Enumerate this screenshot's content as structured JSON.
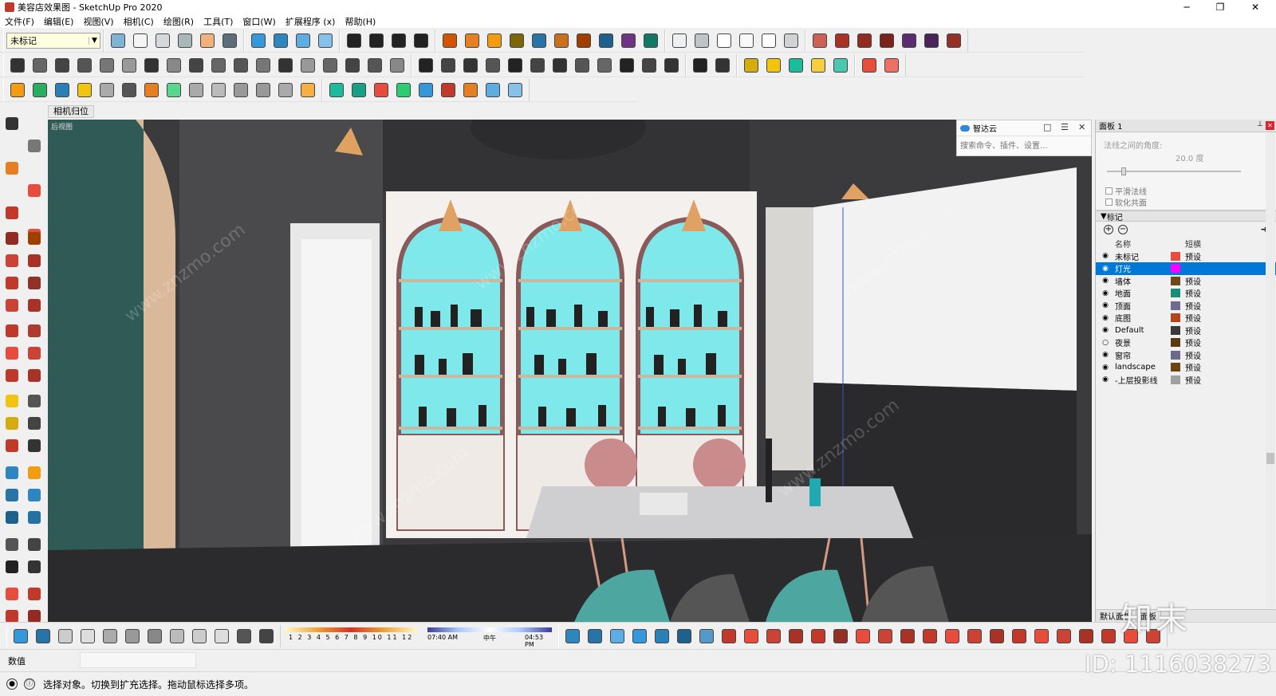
{
  "window": {
    "title": "美容店效果图 - SketchUp Pro 2020",
    "minimize": "─",
    "maximize": "❐",
    "close": "✕"
  },
  "menu": [
    "文件(F)",
    "编辑(E)",
    "视图(V)",
    "相机(C)",
    "绘图(R)",
    "工具(T)",
    "窗口(W)",
    "扩展程序 (x)",
    "帮助(H)"
  ],
  "toolbar": {
    "active_tag": "未标记"
  },
  "scene_tab": "相机归位",
  "viewport": {
    "label": "后视图",
    "watermark": "www.znzmo.com"
  },
  "search": {
    "title": "智达云",
    "placeholder": "搜索命令、插件、设置..."
  },
  "tray": {
    "title": "面板 1",
    "soften": {
      "angle_label": "法线之间的角度:",
      "angle_value": "20.0 度",
      "smooth_normals": "平滑法线",
      "soften_coplanar": "软化共面"
    },
    "tags_section_title": "标记",
    "tags_headers": {
      "name": "名称",
      "dash": "短横"
    },
    "tags": [
      {
        "name": "未标记",
        "color": "#e84c3d",
        "dash": "预设",
        "visible": true
      },
      {
        "name": "灯光",
        "color": "#ff00ff",
        "dash": "",
        "visible": true,
        "selected": true
      },
      {
        "name": "墙体",
        "color": "#6b4a1a",
        "dash": "预设",
        "visible": true
      },
      {
        "name": "地面",
        "color": "#1a8c7a",
        "dash": "预设",
        "visible": true
      },
      {
        "name": "顶面",
        "color": "#6f6a8f",
        "dash": "预设",
        "visible": true
      },
      {
        "name": "底图",
        "color": "#b5431b",
        "dash": "预设",
        "visible": true
      },
      {
        "name": "Default",
        "color": "#3a3a3a",
        "dash": "预设",
        "visible": true
      },
      {
        "name": "夜景",
        "color": "#5a3a10",
        "dash": "预设",
        "visible": false
      },
      {
        "name": "窗帘",
        "color": "#6a6a8a",
        "dash": "预设",
        "visible": true
      },
      {
        "name": "landscape",
        "color": "#6a4510",
        "dash": "预设",
        "visible": true
      },
      {
        "name": "-上层投影线",
        "color": "#a0a0a0",
        "dash": "预设",
        "visible": true
      }
    ],
    "bottom_tabs": [
      "默认面板",
      "面板"
    ]
  },
  "shadow": {
    "months": "1 2 3 4 5 6 7 8 9 10 11 12",
    "time_start": "07:40 AM",
    "time_mid": "中午",
    "time_end": "04:53 PM"
  },
  "measurements": {
    "label": "数值"
  },
  "status": {
    "info_icon": "ⓘ",
    "message": "选择对象。切换到扩充选择。拖动鼠标选择多项。"
  },
  "overlay": {
    "brand": "知末",
    "id": "ID: 1116038273"
  }
}
